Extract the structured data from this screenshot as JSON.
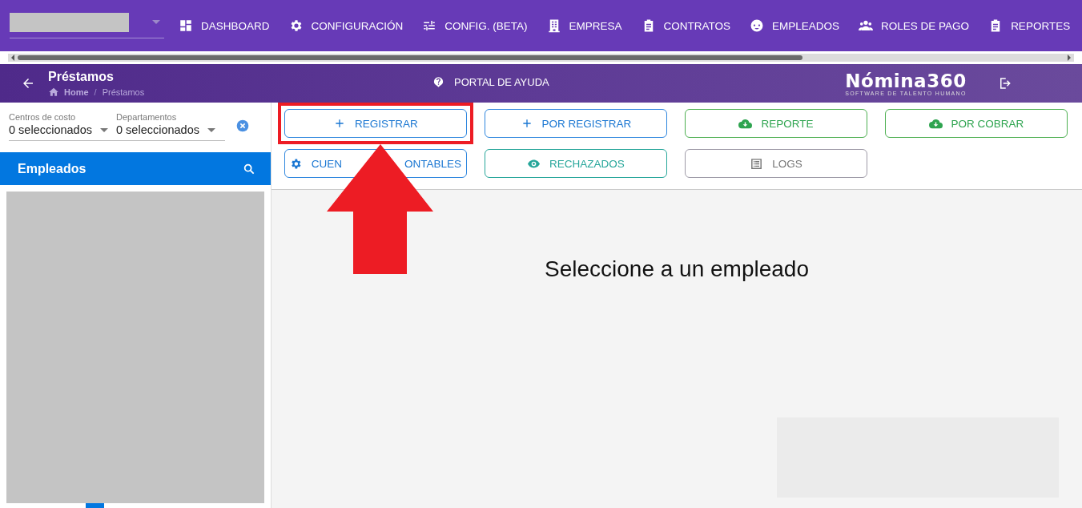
{
  "nav": {
    "items": [
      {
        "kind": "dashboard",
        "label": "DASHBOARD"
      },
      {
        "kind": "settings",
        "label": "CONFIGURACIÓN"
      },
      {
        "kind": "tuning",
        "label": "CONFIG. (BETA)"
      },
      {
        "kind": "company",
        "label": "EMPRESA"
      },
      {
        "kind": "document",
        "label": "CONTRATOS"
      },
      {
        "kind": "person",
        "label": "EMPLEADOS"
      },
      {
        "kind": "group",
        "label": "ROLES DE PAGO"
      },
      {
        "kind": "document",
        "label": "REPORTES"
      }
    ]
  },
  "header": {
    "title": "Préstamos",
    "breadcrumb": [
      "Home",
      "Préstamos"
    ],
    "breadcrumb_separator": "/",
    "help": "PORTAL DE AYUDA",
    "logo": "Nómina360",
    "logo_tagline": "SOFTWARE DE TALENTO HUMANO"
  },
  "filters": [
    {
      "label": "Centros de costo",
      "value": "0 seleccionados"
    },
    {
      "label": "Departamentos",
      "value": "0 seleccionados"
    }
  ],
  "employees": {
    "title": "Empleados"
  },
  "actions": [
    {
      "kind": "add",
      "label_parts": [
        "REGISTRAR"
      ],
      "highlighted": true
    },
    {
      "kind": "add",
      "label_parts": [
        "POR REGISTRAR"
      ],
      "highlighted": false
    },
    {
      "kind": "download",
      "label_parts": [
        "REPORTE"
      ],
      "highlighted": false
    },
    {
      "kind": "download",
      "label_parts": [
        "POR COBRAR"
      ],
      "highlighted": false
    },
    {
      "kind": "settings",
      "label_parts": [
        "CUEN",
        "ONTABLES"
      ],
      "highlighted": false
    },
    {
      "kind": "view",
      "label_parts": [
        "RECHAZADOS"
      ],
      "highlighted": false
    },
    {
      "kind": "log",
      "label_parts": [
        "LOGS"
      ],
      "highlighted": false
    }
  ],
  "message": "Seleccione a un empleado"
}
